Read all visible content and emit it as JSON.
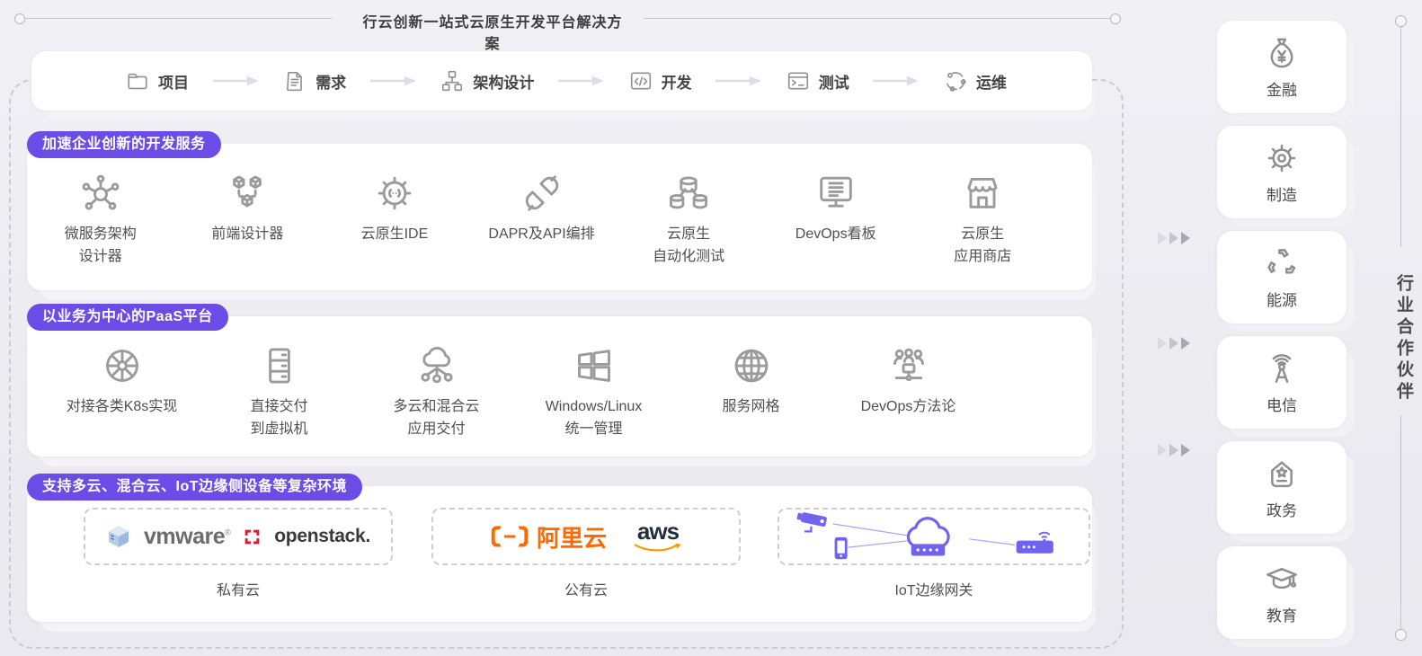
{
  "title": "行云创新一站式云原生开发平台解决方案",
  "workflow": {
    "steps": [
      {
        "icon": "folder-icon",
        "label": "项目"
      },
      {
        "icon": "document-icon",
        "label": "需求"
      },
      {
        "icon": "sitemap-icon",
        "label": "架构设计"
      },
      {
        "icon": "code-window-icon",
        "label": "开发"
      },
      {
        "icon": "terminal-icon",
        "label": "测试"
      },
      {
        "icon": "ops-cycle-icon",
        "label": "运维"
      }
    ]
  },
  "sections": [
    {
      "badge": "加速企业创新的开发服务",
      "items": [
        {
          "icon": "microservice-icon",
          "lines": [
            "微服务架构",
            "设计器"
          ]
        },
        {
          "icon": "cubes-icon",
          "lines": [
            "前端设计器"
          ]
        },
        {
          "icon": "gear-code-icon",
          "lines": [
            "云原生IDE"
          ]
        },
        {
          "icon": "plug-icon",
          "lines": [
            "DAPR及API编排"
          ]
        },
        {
          "icon": "databases-icon",
          "lines": [
            "云原生",
            "自动化测试"
          ]
        },
        {
          "icon": "kanban-monitor-icon",
          "lines": [
            "DevOps看板"
          ]
        },
        {
          "icon": "storefront-icon",
          "lines": [
            "云原生",
            "应用商店"
          ]
        }
      ]
    },
    {
      "badge": "以业务为中心的PaaS平台",
      "items": [
        {
          "icon": "k8s-wheel-icon",
          "lines": [
            "对接各类K8s实现"
          ]
        },
        {
          "icon": "server-icon",
          "lines": [
            "直接交付",
            "到虚拟机"
          ]
        },
        {
          "icon": "cloud-network-icon",
          "lines": [
            "多云和混合云",
            "应用交付"
          ]
        },
        {
          "icon": "windows-icon",
          "lines": [
            "Windows/Linux",
            "统一管理"
          ]
        },
        {
          "icon": "globe-icon",
          "lines": [
            "服务网格"
          ]
        },
        {
          "icon": "team-icon",
          "lines": [
            "DevOps方法论"
          ]
        }
      ]
    }
  ],
  "environments": {
    "badge": "支持多云、混合云、IoT边缘侧设备等复杂环境",
    "groups": [
      {
        "label": "私有云",
        "logos": [
          {
            "name": "vmware",
            "text": "vmware",
            "mark": "®"
          },
          {
            "name": "openstack",
            "text": "openstack."
          }
        ]
      },
      {
        "label": "公有云",
        "logos": [
          {
            "name": "alibaba-cloud",
            "text": "阿里云"
          },
          {
            "name": "aws",
            "text": "aws"
          }
        ]
      },
      {
        "label": "IoT边缘网关",
        "logos": [
          {
            "name": "iot-devices"
          }
        ]
      }
    ]
  },
  "sidebar": {
    "vertical_label": "行业合作伙伴",
    "items": [
      {
        "icon": "money-bag-icon",
        "label": "金融"
      },
      {
        "icon": "gear-icon",
        "label": "制造"
      },
      {
        "icon": "recycle-icon",
        "label": "能源"
      },
      {
        "icon": "antenna-icon",
        "label": "电信"
      },
      {
        "icon": "government-icon",
        "label": "政务"
      },
      {
        "icon": "education-icon",
        "label": "教育"
      }
    ]
  },
  "colors": {
    "accent_purple": "#6B4CE6",
    "icon_gray": "#9B9B9B",
    "iot_purple": "#6F63EF",
    "alibaba_orange": "#FF6A00",
    "aws_navy": "#232F3E",
    "aws_orange": "#FF9900",
    "openstack_red": "#DA1A32",
    "vmware_gray": "#6E6B70"
  }
}
